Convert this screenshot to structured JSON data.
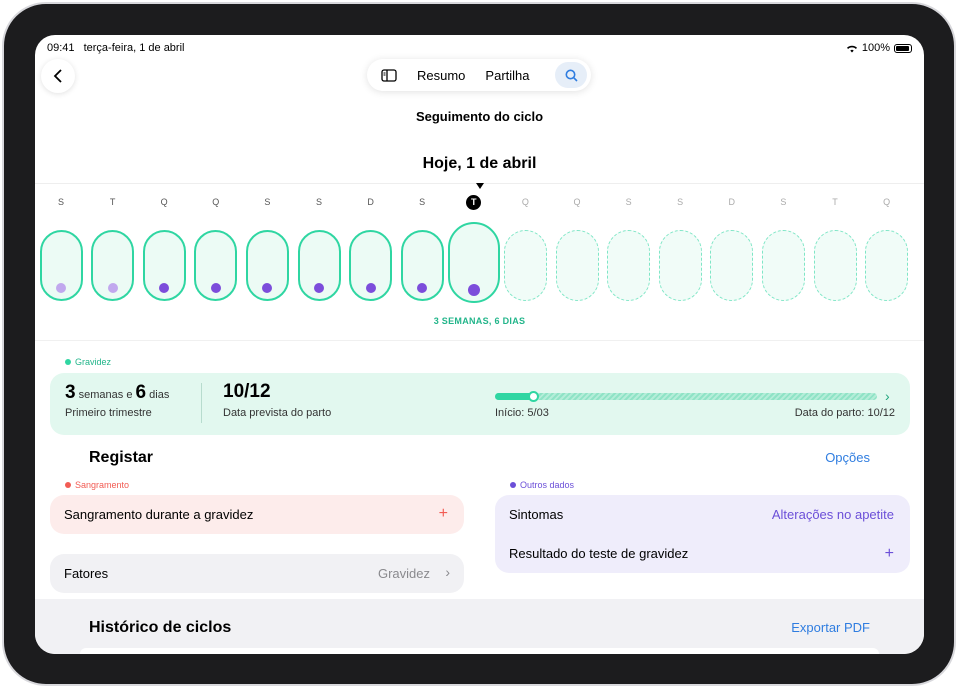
{
  "status": {
    "time": "09:41",
    "date": "terça-feira, 1 de abril",
    "battery": "100%"
  },
  "toolbar": {
    "summary_label": "Resumo",
    "share_label": "Partilha"
  },
  "nav": {
    "title": "Seguimento do ciclo"
  },
  "timeline": {
    "date_title": "Hoje, 1 de abril",
    "days": [
      {
        "letter": "S",
        "state": "past",
        "dot": "light"
      },
      {
        "letter": "T",
        "state": "past",
        "dot": "light"
      },
      {
        "letter": "Q",
        "state": "past",
        "dot": "dark"
      },
      {
        "letter": "Q",
        "state": "past",
        "dot": "dark"
      },
      {
        "letter": "S",
        "state": "past",
        "dot": "dark"
      },
      {
        "letter": "S",
        "state": "past",
        "dot": "dark"
      },
      {
        "letter": "D",
        "state": "past",
        "dot": "dark"
      },
      {
        "letter": "S",
        "state": "past",
        "dot": "dark"
      },
      {
        "letter": "T",
        "state": "today",
        "dot": "dark"
      },
      {
        "letter": "Q",
        "state": "future",
        "dot": "none"
      },
      {
        "letter": "Q",
        "state": "future",
        "dot": "none"
      },
      {
        "letter": "S",
        "state": "future",
        "dot": "none"
      },
      {
        "letter": "S",
        "state": "future",
        "dot": "none"
      },
      {
        "letter": "D",
        "state": "future",
        "dot": "none"
      },
      {
        "letter": "S",
        "state": "future",
        "dot": "none"
      },
      {
        "letter": "T",
        "state": "future",
        "dot": "none"
      },
      {
        "letter": "Q",
        "state": "future",
        "dot": "none"
      }
    ],
    "weeks_label": "3 SEMANAS, 6 DIAS"
  },
  "pregnancy": {
    "tag": "Gravidez",
    "weeks": "3",
    "weeks_unit": "semanas e",
    "days": "6",
    "days_unit": "dias",
    "trimester": "Primeiro trimestre",
    "due_date": "10/12",
    "due_label": "Data prevista do parto",
    "progress": 0.1,
    "start_label": "Início: 5/03",
    "end_label": "Data do parto: 10/12"
  },
  "register": {
    "title": "Registar",
    "options": "Opções",
    "bleeding_tag": "Sangramento",
    "bleeding_row": "Sangramento durante a gravidez",
    "factors_label": "Fatores",
    "factors_value": "Gravidez",
    "other_tag": "Outros dados",
    "symptoms_label": "Sintomas",
    "symptoms_value": "Alterações no apetite",
    "test_label": "Resultado do teste de gravidez"
  },
  "history": {
    "title": "Histórico de ciclos",
    "export": "Exportar PDF"
  },
  "colors": {
    "accent": "#2fd6a2",
    "link": "#2f7de0",
    "purple": "#7c4ddb",
    "bleeding": "#f25c54"
  }
}
